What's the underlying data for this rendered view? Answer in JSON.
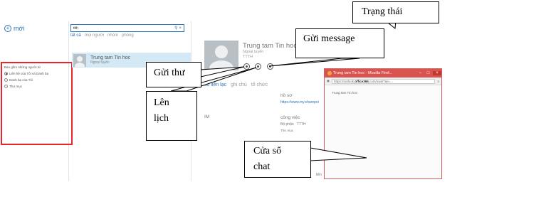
{
  "app": {
    "new_label": "mới",
    "filter": {
      "title": "Bao gồm những người từ",
      "options": [
        {
          "label": "Liên hệ của Tôi và Danh bạ",
          "selected": true
        },
        {
          "label": "Danh bạ của Tôi",
          "selected": false
        },
        {
          "label": "Thư mục",
          "selected": false
        }
      ]
    },
    "search": {
      "query": "ttth",
      "search_icon": "search-icon",
      "clear_icon": "close-icon"
    },
    "scope_tabs": [
      "tất cả",
      "mọi người",
      "nhóm",
      "phòng"
    ],
    "result": {
      "name": "Trung tam Tin hoc",
      "status": "Ngoại tuyến"
    },
    "contact": {
      "name": "Trung tam Tin hoc",
      "status_lines": [
        "Ngoại tuyến",
        "TTTH"
      ],
      "tabs": [
        "sổ liên lạc",
        "ghi chú",
        "tổ chức"
      ],
      "profile_label": "hồ sơ",
      "profile_link": "https://www.my.sharepoi",
      "im_label": "IM",
      "work_label": "công việc",
      "dept_label": "Bộ phận",
      "dept_value": "TTTH",
      "folder_label": "Thư mục"
    },
    "firefox": {
      "title": "Trung tam Tin hoc - Mozilla Firef...",
      "url_prefix": "https://outlook.",
      "url_domain": "office365",
      "url_suffix": ".com/owa/?ae=...",
      "body_text": "Trung tam Tin hoc",
      "minimize": "–",
      "maximize": "□",
      "close": "×"
    },
    "partial_text": "liên",
    "accent": "#2a71b8",
    "highlight": "#e8262a"
  },
  "callouts": {
    "status": "Trạng  thái",
    "message": "Gửi message",
    "mail": "Gửi thư",
    "schedule": [
      "Lên",
      "lịch"
    ],
    "chat": [
      "Cửa sổ",
      "chat"
    ]
  }
}
